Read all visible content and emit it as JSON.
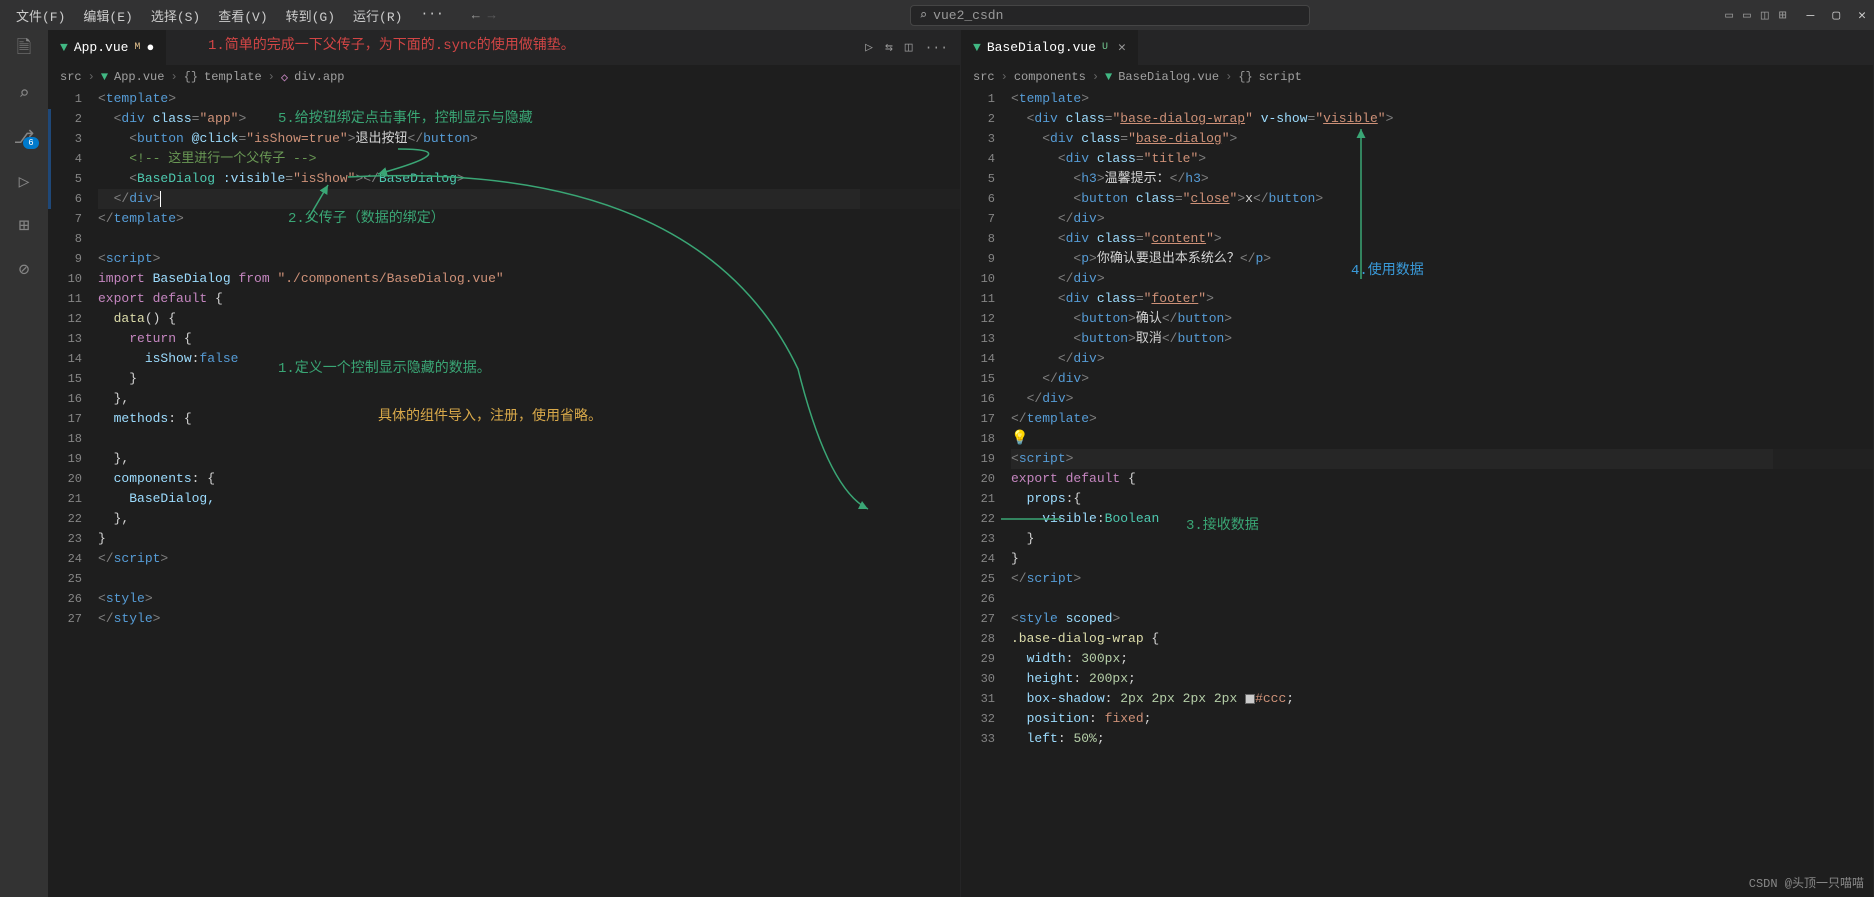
{
  "menu": [
    "文件(F)",
    "编辑(E)",
    "选择(S)",
    "查看(V)",
    "转到(G)",
    "运行(R)",
    "···"
  ],
  "search_text": "vue2_csdn",
  "activity_badge": "6",
  "editors": {
    "left": {
      "tab": {
        "icon": "vue",
        "name": "App.vue",
        "status": "M"
      },
      "breadcrumb": [
        "src",
        "App.vue",
        "template",
        "div.app"
      ],
      "lines": [
        "1",
        "2",
        "3",
        "4",
        "5",
        "6",
        "7",
        "8",
        "9",
        "10",
        "11",
        "12",
        "13",
        "14",
        "15",
        "16",
        "17",
        "18",
        "19",
        "20",
        "21",
        "22",
        "23",
        "24",
        "25",
        "26",
        "27"
      ]
    },
    "right": {
      "tab": {
        "icon": "vue",
        "name": "BaseDialog.vue",
        "status": "U"
      },
      "breadcrumb": [
        "src",
        "components",
        "BaseDialog.vue",
        "script"
      ],
      "lines": [
        "1",
        "2",
        "3",
        "4",
        "5",
        "6",
        "7",
        "8",
        "9",
        "10",
        "11",
        "12",
        "13",
        "14",
        "15",
        "16",
        "17",
        "18",
        "19",
        "20",
        "21",
        "22",
        "23",
        "24",
        "25",
        "26",
        "27",
        "28",
        "29",
        "30",
        "31",
        "32",
        "33"
      ]
    }
  },
  "code_left": {
    "l1": {
      "a": "<",
      "b": "template",
      "c": ">"
    },
    "l2": {
      "a": "<",
      "b": "div",
      "c": " class",
      "d": "=",
      "e": "\"app\"",
      "f": ">"
    },
    "l3": {
      "a": "<",
      "b": "button",
      "c": " @click",
      "d": "=",
      "e": "\"isShow=true\"",
      "f": ">",
      "g": "退出按钮",
      "h": "</",
      "i": "button",
      "j": ">"
    },
    "l4": {
      "a": "<!-- 这里进行一个父传子 -->"
    },
    "l5": {
      "a": "<",
      "b": "BaseDialog",
      "c": " :visible",
      "d": "=",
      "e": "\"isShow\"",
      "f": "></",
      "g": "BaseDialog",
      "h": ">"
    },
    "l6": {
      "a": "</",
      "b": "div",
      "c": ">"
    },
    "l7": {
      "a": "</",
      "b": "template",
      "c": ">"
    },
    "l9": {
      "a": "<",
      "b": "script",
      "c": ">"
    },
    "l10": {
      "a": "import",
      "b": " BaseDialog ",
      "c": "from",
      "d": " \"./components/BaseDialog.vue\""
    },
    "l11": {
      "a": "export default",
      "b": " {"
    },
    "l12": {
      "a": "data",
      "b": "() {"
    },
    "l13": {
      "a": "return",
      "b": " {"
    },
    "l14": {
      "a": "isShow",
      "b": ":",
      "c": "false"
    },
    "l15": "}",
    "l16": "},",
    "l17": {
      "a": "methods",
      "b": ": {"
    },
    "l19": "},",
    "l20": {
      "a": "components",
      "b": ": {"
    },
    "l21": "BaseDialog,",
    "l22": "},",
    "l23": "}",
    "l24": {
      "a": "</",
      "b": "script",
      "c": ">"
    },
    "l26": {
      "a": "<",
      "b": "style",
      "c": ">"
    },
    "l27": {
      "a": "</",
      "b": "style",
      "c": ">"
    }
  },
  "code_right": {
    "l1": {
      "a": "<",
      "b": "template",
      "c": ">"
    },
    "l2": {
      "a": "<",
      "b": "div",
      "c": " class",
      "d": "=",
      "e": "\"",
      "f": "base-dialog-wrap",
      "g": "\"",
      "h": " v-show",
      "i": "=",
      "j": "\"",
      "k": "visible",
      "l": "\"",
      "m": ">"
    },
    "l3": {
      "a": "<",
      "b": "div",
      "c": " class",
      "d": "=",
      "e": "\"",
      "f": "base-dialog",
      "g": "\"",
      "h": ">"
    },
    "l4": {
      "a": "<",
      "b": "div",
      "c": " class",
      "d": "=",
      "e": "\"title\"",
      "f": ">"
    },
    "l5": {
      "a": "<",
      "b": "h3",
      "c": ">",
      "d": "温馨提示：",
      "e": "</",
      "f": "h3",
      "g": ">"
    },
    "l6": {
      "a": "<",
      "b": "button",
      "c": " class",
      "d": "=",
      "e": "\"",
      "f": "close",
      "g": "\"",
      "h": ">",
      "i": "x",
      "j": "</",
      "k": "button",
      "l": ">"
    },
    "l7": {
      "a": "</",
      "b": "div",
      "c": ">"
    },
    "l8": {
      "a": "<",
      "b": "div",
      "c": " class",
      "d": "=",
      "e": "\"",
      "f": "content",
      "g": "\"",
      "h": ">"
    },
    "l9": {
      "a": "<",
      "b": "p",
      "c": ">",
      "d": "你确认要退出本系统么？",
      "e": "</",
      "f": "p",
      "g": ">"
    },
    "l10": {
      "a": "</",
      "b": "div",
      "c": ">"
    },
    "l11": {
      "a": "<",
      "b": "div",
      "c": " class",
      "d": "=",
      "e": "\"",
      "f": "footer",
      "g": "\"",
      "h": ">"
    },
    "l12": {
      "a": "<",
      "b": "button",
      "c": ">",
      "d": "确认",
      "e": "</",
      "f": "button",
      "g": ">"
    },
    "l13": {
      "a": "<",
      "b": "button",
      "c": ">",
      "d": "取消",
      "e": "</",
      "f": "button",
      "g": ">"
    },
    "l14": {
      "a": "</",
      "b": "div",
      "c": ">"
    },
    "l15": {
      "a": "</",
      "b": "div",
      "c": ">"
    },
    "l16": {
      "a": "</",
      "b": "div",
      "c": ">"
    },
    "l17": {
      "a": "</",
      "b": "template",
      "c": ">"
    },
    "l19": {
      "a": "<",
      "b": "script",
      "c": ">"
    },
    "l20": {
      "a": "export default",
      "b": " {"
    },
    "l21": {
      "a": "props",
      "b": ":{"
    },
    "l22": {
      "a": "visible",
      "b": ":",
      "c": "Boolean"
    },
    "l23": "}",
    "l24": "}",
    "l25": {
      "a": "</",
      "b": "script",
      "c": ">"
    },
    "l27": {
      "a": "<",
      "b": "style",
      "c": " scoped",
      "d": ">"
    },
    "l28": {
      "a": ".base-dialog-wrap",
      "b": " {"
    },
    "l29": {
      "a": "width",
      "b": ": ",
      "c": "300px",
      "d": ";"
    },
    "l30": {
      "a": "height",
      "b": ": ",
      "c": "200px",
      "d": ";"
    },
    "l31": {
      "a": "box-shadow",
      "b": ": ",
      "c": "2px 2px 2px 2px",
      "d": " ",
      "e": "#ccc",
      "f": ";"
    },
    "l32": {
      "a": "position",
      "b": ": ",
      "c": "fixed",
      "d": ";"
    },
    "l33": {
      "a": "left",
      "b": ": ",
      "c": "50%",
      "d": ";"
    }
  },
  "annotations": {
    "a1": "1.简单的完成一下父传子，为下面的.sync的使用做铺垫。",
    "a5": "5.给按钮绑定点击事件，控制显示与隐藏",
    "a2": "2.父传子（数据的绑定）",
    "a1b": "1.定义一个控制显示隐藏的数据。",
    "ay": "具体的组件导入，注册，使用省略。",
    "a4": "4.使用数据",
    "a3": "3.接收数据"
  },
  "watermark": "CSDN @头顶一只喵喵"
}
